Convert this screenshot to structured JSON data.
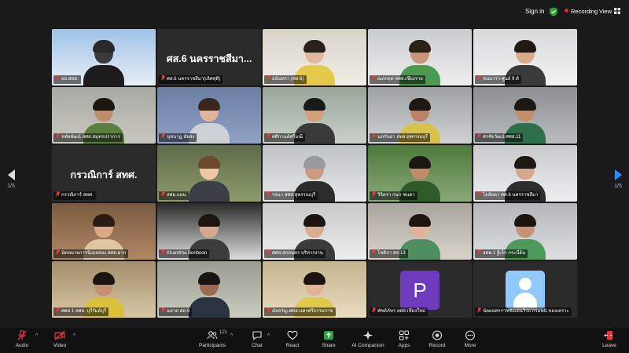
{
  "topbar": {
    "signin_label": "Sign in",
    "recording_label": "Recording",
    "view_label": "View",
    "colors": {
      "shield": "#2ea043",
      "recording_dot": "#e02828"
    }
  },
  "pager": {
    "left": "1/5",
    "right": "1/5"
  },
  "tiles": [
    {
      "name": "ผอ.สทส.",
      "type": "video",
      "active": true
    },
    {
      "name": "ศส.6 นครราชสีมา(เลิศสุดิ)",
      "type": "label",
      "big": "ศส.6 นครราชสีมา..."
    },
    {
      "name": "อนันทรา (ศส.6)",
      "type": "video"
    },
    {
      "name": "ณภกฤต สศส.เชียงราย",
      "type": "video"
    },
    {
      "name": "ชนนารา ศูนย์ 9 ตั",
      "type": "video"
    },
    {
      "name": "หทัยพัฒน์ สศส.สมุทรปราการ",
      "type": "video"
    },
    {
      "name": "นุชนาฏ ทัยสง",
      "type": "video"
    },
    {
      "name": "ศศิกานต์ศรีมณี",
      "type": "video"
    },
    {
      "name": "นภกันยา สทส.สุพรรณบุรี",
      "type": "video"
    },
    {
      "name": "ศรชัยวัฒน์ ศศส.11",
      "type": "video"
    },
    {
      "name": "กรวณิการ์ สทศ.",
      "type": "label",
      "big": "กรวณิการ์ สทศ."
    },
    {
      "name": "สศม.แผน",
      "type": "video"
    },
    {
      "name": "รจนา สศส.สุพรรณบุรี",
      "type": "video"
    },
    {
      "name": "วิจิตรา กนก ชนตา",
      "type": "video"
    },
    {
      "name": "ไอลัดดา ศศ.6 นครราชสีมา",
      "type": "video"
    },
    {
      "name": "นัดหมายการนิเมลสอง สศส.ตาก",
      "type": "video"
    },
    {
      "name": "Khanittha Boriboon",
      "type": "video"
    },
    {
      "name": "ศศส.สกลนคร บริหารงาน",
      "type": "video"
    },
    {
      "name": "โชติกา ศส.13",
      "type": "video"
    },
    {
      "name": "สสพ.1 ฐีเล็ก กระบี่ฮ้น",
      "type": "video"
    },
    {
      "name": "ศศส 1 สศส. บุรีรัมย์บุรี",
      "type": "video"
    },
    {
      "name": "ฉลาด ศส.6",
      "type": "video"
    },
    {
      "name": "มัลลวัญ ศศส.นครศรีธรรมราช",
      "type": "video"
    },
    {
      "name": "พัชต์ภัทร สศส.เชียงใหม่",
      "type": "avatar",
      "initial": "P"
    },
    {
      "name": "นัตผลสกราชชัยเคนวิรถ กรมพนิ หลงเคราะ",
      "type": "avatar_user"
    }
  ],
  "toolbar": {
    "audio": "Audio",
    "video": "Video",
    "participants": "Participants",
    "participants_count": "121",
    "chat": "Chat",
    "react": "React",
    "share": "Share",
    "ai_companion": "AI Companion",
    "apps": "Apps",
    "record": "Record",
    "more": "More",
    "leave": "Leave",
    "colors": {
      "muted": "#e23c3c",
      "share": "#2ea043",
      "leave": "#e23c3c"
    }
  }
}
